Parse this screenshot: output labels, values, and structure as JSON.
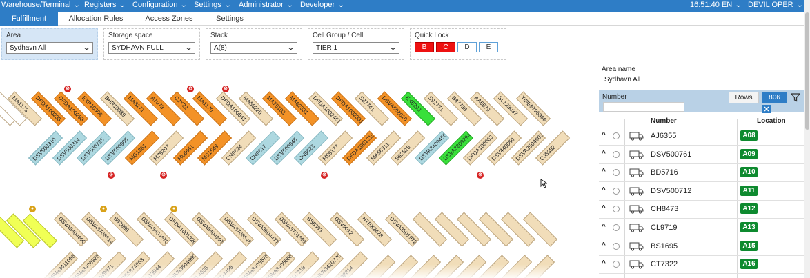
{
  "menu": [
    {
      "label": "Warehouse/Terminal"
    },
    {
      "label": "Registers"
    },
    {
      "label": "Configuration"
    },
    {
      "label": "Settings"
    },
    {
      "label": "Administrator"
    },
    {
      "label": "Developer"
    }
  ],
  "status": {
    "time": "16:51:40",
    "lang": "EN",
    "user": "DEVIL OPER"
  },
  "tabs": [
    {
      "label": "Fulfillment",
      "active": true
    },
    {
      "label": "Allocation Rules"
    },
    {
      "label": "Access Zones"
    },
    {
      "label": "Settings"
    }
  ],
  "filters": {
    "area": {
      "label": "Area",
      "value": "Sydhavn All"
    },
    "storage": {
      "label": "Storage space",
      "value": "SYDHAVN FULL"
    },
    "stack": {
      "label": "Stack",
      "value": "A(8)"
    },
    "cell": {
      "label": "Cell Group / Cell",
      "value": "TIER 1"
    },
    "quicklock": {
      "label": "Quick Lock",
      "buttons": [
        "B",
        "C",
        "D",
        "E"
      ]
    }
  },
  "map": {
    "top_row": [
      "MA1173",
      "DFDA100285",
      "DFDA100293",
      "EXP10306",
      "BHR10039",
      "MA3171",
      "A1073",
      "CJX22",
      "MA1170",
      "DFDA100541",
      "MA56220",
      "MA75103",
      "MA62831",
      "DFDA1002467",
      "DFDA1002891",
      "S87741",
      "DSVA502010",
      "EX6293",
      "S92771",
      "S87738",
      "AA6679",
      "SL123037",
      "TIPE5796966"
    ],
    "top_lower": [
      "DSV500310",
      "DSV500314",
      "DSV500725",
      "DSV500905",
      "MG1261",
      "M75207",
      "ML6651",
      "MS1549",
      "CN9624",
      "CN9617",
      "DSV500945",
      "CN9623",
      "M55177",
      "DFDA1001215",
      "MA56311",
      "S92818",
      "DSVA3409450",
      "DSVA3209294",
      "DFDA100063",
      "DSV440050",
      "DSVA3504903",
      "CJ5352"
    ],
    "bottom_row": [
      "DSVA3404690",
      "DSVA3708614",
      "S92869",
      "DSVA3404670",
      "DFDA1001326",
      "DSVA3404297",
      "DSVA3708548",
      "DSVA3604477",
      "DSVA3701651",
      "BS5393",
      "DSV9012",
      "NTEX2428",
      "DSVA3501972"
    ],
    "bottom_lower": [
      "DSVA3411056",
      "DSVA3406928",
      "HW9971",
      "IPE5874863",
      "CG3944",
      "DSVA3504550",
      "BL4686",
      "AD4495",
      "DSVA3403575",
      "DSVA3405855",
      "AD7118",
      "DSVA3410770",
      "S92814"
    ]
  },
  "panel": {
    "area_label": "Area name",
    "area_value": "Sydhavn All",
    "number_label": "Number",
    "rows_button": "Rows",
    "count": "806",
    "col_number": "Number",
    "col_location": "Location",
    "rows": [
      {
        "number": "AJ6355",
        "location": "A08"
      },
      {
        "number": "DSV500761",
        "location": "A09"
      },
      {
        "number": "BD5716",
        "location": "A10"
      },
      {
        "number": "DSV500712",
        "location": "A11"
      },
      {
        "number": "CH8473",
        "location": "A12"
      },
      {
        "number": "CL9719",
        "location": "A13"
      },
      {
        "number": "BS1695",
        "location": "A15"
      },
      {
        "number": "CT7322",
        "location": "A16"
      }
    ]
  },
  "colors": {
    "topbar": "#2e7dc6",
    "location_badge": "#0e8a2f",
    "lock_red": "#ee1111"
  }
}
